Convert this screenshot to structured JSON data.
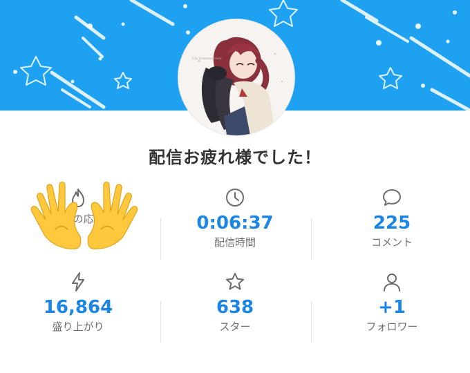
{
  "banner": {
    "background_color": "#1ea1f1",
    "accent_color": "#ffffff"
  },
  "avatar": {
    "image_caption": "Lin Summerview",
    "icon": "anime-girl-illustration"
  },
  "title": "配信お疲れ様でした！",
  "stats": [
    {
      "key": "support",
      "icon": "flame-icon",
      "value": "",
      "label": "今日の応援"
    },
    {
      "key": "duration",
      "icon": "clock-icon",
      "value": "0:06:37",
      "label": "配信時間"
    },
    {
      "key": "comments",
      "icon": "speech-bubble-icon",
      "value": "225",
      "label": "コメント"
    },
    {
      "key": "excitement",
      "icon": "lightning-icon",
      "value": "16,864",
      "label": "盛り上がり"
    },
    {
      "key": "stars",
      "icon": "star-icon",
      "value": "638",
      "label": "スター"
    },
    {
      "key": "followers",
      "icon": "person-icon",
      "value": "+1",
      "label": "フォロワー"
    }
  ],
  "overlay": {
    "icon": "raised-hands-emoji"
  },
  "colors": {
    "value_blue": "#1a85e3",
    "icon_gray": "#6b6b6b",
    "label_gray": "#6f6f6f",
    "title_dark": "#333333"
  }
}
